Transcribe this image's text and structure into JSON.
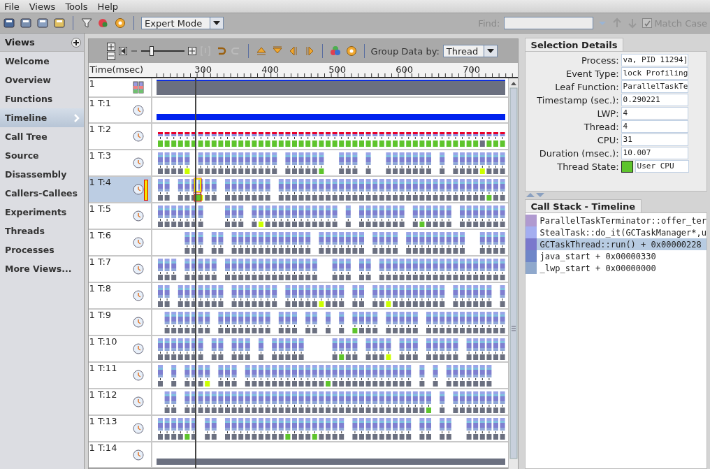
{
  "menu": [
    "File",
    "Views",
    "Tools",
    "Help"
  ],
  "toolbar": {
    "mode": "Expert Mode",
    "find_label": "Find:",
    "match_case": {
      "label": "Match Case",
      "checked": true,
      "disabled": true
    }
  },
  "sidebar": {
    "title": "Views",
    "items": [
      {
        "label": "Welcome",
        "selected": false
      },
      {
        "label": "Overview",
        "selected": false
      },
      {
        "label": "Functions",
        "selected": false
      },
      {
        "label": "Timeline",
        "selected": true
      },
      {
        "label": "Call Tree",
        "selected": false
      },
      {
        "label": "Source",
        "selected": false
      },
      {
        "label": "Disassembly",
        "selected": false
      },
      {
        "label": "Callers-Callees",
        "selected": false
      },
      {
        "label": "Experiments",
        "selected": false
      },
      {
        "label": "Threads",
        "selected": false
      },
      {
        "label": "Processes",
        "selected": false
      },
      {
        "label": "More Views...",
        "selected": false
      }
    ]
  },
  "timeline": {
    "zoom_slider": {
      "level": 0.22
    },
    "group_label": "Group Data by:",
    "group_value": "Thread",
    "axis_title": "Time(msec)",
    "axis_ticks": [
      "300",
      "400",
      "500",
      "600",
      "700"
    ],
    "rows": [
      {
        "label": "1",
        "kind": "summary",
        "selected": false
      },
      {
        "label": "1 T:1",
        "kind": "bar",
        "color": "#0022ee",
        "selected": false
      },
      {
        "label": "1 T:2",
        "kind": "states",
        "selected": false
      },
      {
        "label": "1 T:3",
        "kind": "samples",
        "selected": false
      },
      {
        "label": "1 T:4",
        "kind": "samples",
        "selected": true
      },
      {
        "label": "1 T:5",
        "kind": "samples",
        "selected": false
      },
      {
        "label": "1 T:6",
        "kind": "samples",
        "selected": false
      },
      {
        "label": "1 T:7",
        "kind": "samples",
        "selected": false
      },
      {
        "label": "1 T:8",
        "kind": "samples",
        "selected": false
      },
      {
        "label": "1 T:9",
        "kind": "samples",
        "selected": false
      },
      {
        "label": "1 T:10",
        "kind": "samples",
        "selected": false
      },
      {
        "label": "1 T:11",
        "kind": "samples",
        "selected": false
      },
      {
        "label": "1 T:12",
        "kind": "samples",
        "selected": false
      },
      {
        "label": "1 T:13",
        "kind": "samples",
        "selected": false
      },
      {
        "label": "1 T:14",
        "kind": "bar",
        "color": "#6b7080",
        "selected": false
      }
    ]
  },
  "selection_details": {
    "title": "Selection Details",
    "fields": [
      {
        "label": "Process:",
        "value": "va, PID 11294]"
      },
      {
        "label": "Event Type:",
        "value": "lock Profiling"
      },
      {
        "label": "Leaf Function:",
        "value": "ParallelTaskTe"
      },
      {
        "label": "Timestamp (sec.):",
        "value": "0.290221"
      },
      {
        "label": "LWP:",
        "value": "4"
      },
      {
        "label": "Thread:",
        "value": "4"
      },
      {
        "label": "CPU:",
        "value": "31"
      },
      {
        "label": "Duration (msec.):",
        "value": "10.007"
      },
      {
        "label": "Thread State:",
        "value": "User CPU",
        "color": "#5ec42c"
      }
    ]
  },
  "call_stack": {
    "title": "Call Stack - Timeline",
    "frames": [
      {
        "text": "ParallelTaskTerminator::offer_ter",
        "color": "#b09ad0",
        "selected": false
      },
      {
        "text": "StealTask::do_it(GCTaskManager*,u",
        "color": "#a4aef0",
        "selected": false
      },
      {
        "text": "GCTaskThread::run() + 0x00000228",
        "color": "#7a78cc",
        "selected": true
      },
      {
        "text": "java_start + 0x00000330",
        "color": "#6f86c8",
        "selected": false
      },
      {
        "text": "_lwp_start + 0x00000000",
        "color": "#8fa8cc",
        "selected": false
      }
    ]
  }
}
